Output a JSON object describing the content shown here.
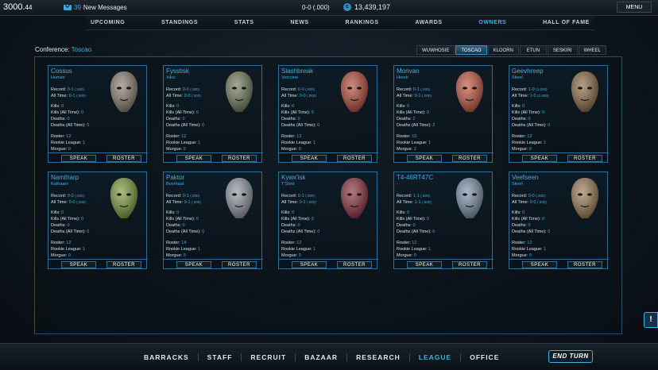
{
  "top": {
    "money_main": "3000.",
    "money_cents": "44",
    "messages_count": "39",
    "messages_label": "New Messages",
    "record": "0-0 (.000)",
    "credits": "13,439,197",
    "menu_label": "MENU"
  },
  "nav_tabs": [
    {
      "label": "UPCOMING",
      "active": false
    },
    {
      "label": "STANDINGS",
      "active": false
    },
    {
      "label": "STATS",
      "active": false
    },
    {
      "label": "NEWS",
      "active": false
    },
    {
      "label": "RANKINGS",
      "active": false
    },
    {
      "label": "AWARDS",
      "active": false
    },
    {
      "label": "OWNERS",
      "active": true
    },
    {
      "label": "HALL OF FAME",
      "active": false
    }
  ],
  "conference": {
    "prefix": "Conference:",
    "name": "Toscao"
  },
  "conference_tabs": [
    {
      "label": "WUWHOSIE",
      "active": false
    },
    {
      "label": "TOSCAO",
      "active": true
    },
    {
      "label": "KLOORN",
      "active": false
    },
    {
      "label": "ETUN",
      "active": false
    },
    {
      "label": "SESKIRI",
      "active": false
    },
    {
      "label": "WHEEL",
      "active": false
    }
  ],
  "card_labels": {
    "record": "Record:",
    "all_time": "All Time:",
    "kills": "Kills:",
    "kills_all_time": "Kills (All Time):",
    "deaths": "Deaths:",
    "deaths_all_time": "Deaths (All Time):",
    "roster": "Roster:",
    "rookie_league": "Rookie League:",
    "morgue": "Morgue:",
    "speak": "SPEAK",
    "roster_btn": "ROSTER"
  },
  "owners": [
    {
      "name": "Cossus",
      "race": "Human",
      "record": "0-1",
      "record_pct": "(.000)",
      "all_time": "0-1",
      "all_time_pct": "(.000)",
      "kills": "0",
      "kills_all_time": "0",
      "deaths": "0",
      "deaths_all_time": "0",
      "roster": "12",
      "rookie_league": "1",
      "morgue": "0",
      "portrait_color": "#8a7e6e"
    },
    {
      "name": "Fysstisk",
      "race": "Xiloc",
      "record": "0-0",
      "record_pct": "(.000)",
      "all_time": "0-0",
      "all_time_pct": "(.000)",
      "kills": "0",
      "kills_all_time": "0",
      "deaths": "0",
      "deaths_all_time": "0",
      "roster": "12",
      "rookie_league": "1",
      "morgue": "0",
      "portrait_color": "#6f7a5a"
    },
    {
      "name": "Slashbreak",
      "race": "Vorccine",
      "record": "0-0",
      "record_pct": "(.000)",
      "all_time": "0-0",
      "all_time_pct": "(.000)",
      "kills": "0",
      "kills_all_time": "0",
      "deaths": "0",
      "deaths_all_time": "0",
      "roster": "12",
      "rookie_league": "1",
      "morgue": "0",
      "portrait_color": "#b4493a"
    },
    {
      "name": "Monvan",
      "race": "Hresh",
      "record": "0-1",
      "record_pct": "(.000)",
      "all_time": "0-1",
      "all_time_pct": "(.000)",
      "kills": "0",
      "kills_all_time": "0",
      "deaths": "2",
      "deaths_all_time": "2",
      "roster": "10",
      "rookie_league": "1",
      "morgue": "2",
      "portrait_color": "#c1553e"
    },
    {
      "name": "Geevhreep",
      "race": "Skeel",
      "record": "1-0",
      "record_pct": "(1.000)",
      "all_time": "1-0",
      "all_time_pct": "(1.000)",
      "kills": "0",
      "kills_all_time": "0",
      "deaths": "0",
      "deaths_all_time": "0",
      "roster": "12",
      "rookie_league": "1",
      "morgue": "0",
      "portrait_color": "#8a6a45"
    },
    {
      "name": "Namtharp",
      "race": "Kathaarn",
      "record": "0-0",
      "record_pct": "(.000)",
      "all_time": "0-0",
      "all_time_pct": "(.000)",
      "kills": "0",
      "kills_all_time": "0",
      "deaths": "0",
      "deaths_all_time": "0",
      "roster": "12",
      "rookie_league": "1",
      "morgue": "0",
      "portrait_color": "#7c9a3a"
    },
    {
      "name": "Paktor",
      "race": "Boorhaal",
      "record": "0-1",
      "record_pct": "(.000)",
      "all_time": "0-1",
      "all_time_pct": "(.000)",
      "kills": "0",
      "kills_all_time": "0",
      "deaths": "0",
      "deaths_all_time": "0",
      "roster": "14",
      "rookie_league": "1",
      "morgue": "0",
      "portrait_color": "#8f96a0"
    },
    {
      "name": "Kywx'isk",
      "race": "T'Shikt",
      "record": "0-1",
      "record_pct": "(.000)",
      "all_time": "0-1",
      "all_time_pct": "(.000)",
      "kills": "0",
      "kills_all_time": "0",
      "deaths": "0",
      "deaths_all_time": "0",
      "roster": "12",
      "rookie_league": "1",
      "morgue": "0",
      "portrait_color": "#8a2e3a"
    },
    {
      "name": "T4-46RT47C",
      "race": "-",
      "record": "1-1",
      "record_pct": "(.500)",
      "all_time": "1-1",
      "all_time_pct": "(.500)",
      "kills": "0",
      "kills_all_time": "0",
      "deaths": "0",
      "deaths_all_time": "0",
      "roster": "12",
      "rookie_league": "1",
      "morgue": "0",
      "portrait_color": "#7a8fa8"
    },
    {
      "name": "Veefseen",
      "race": "Skeel",
      "record": "0-0",
      "record_pct": "(.000)",
      "all_time": "0-0",
      "all_time_pct": "(.000)",
      "kills": "0",
      "kills_all_time": "0",
      "deaths": "0",
      "deaths_all_time": "0",
      "roster": "12",
      "rookie_league": "1",
      "morgue": "0",
      "portrait_color": "#9a7a52"
    }
  ],
  "bottom_nav": [
    {
      "label": "BARRACKS",
      "active": false
    },
    {
      "label": "STAFF",
      "active": false
    },
    {
      "label": "RECRUIT",
      "active": false
    },
    {
      "label": "BAZAAR",
      "active": false
    },
    {
      "label": "RESEARCH",
      "active": false
    },
    {
      "label": "LEAGUE",
      "active": true
    },
    {
      "label": "OFFICE",
      "active": false
    }
  ],
  "end_turn_label": "END TURN",
  "info_label": "!",
  "colors": {
    "accent": "#3fb2e6",
    "card_border": "#2f6f95",
    "background": "#0a1118"
  }
}
